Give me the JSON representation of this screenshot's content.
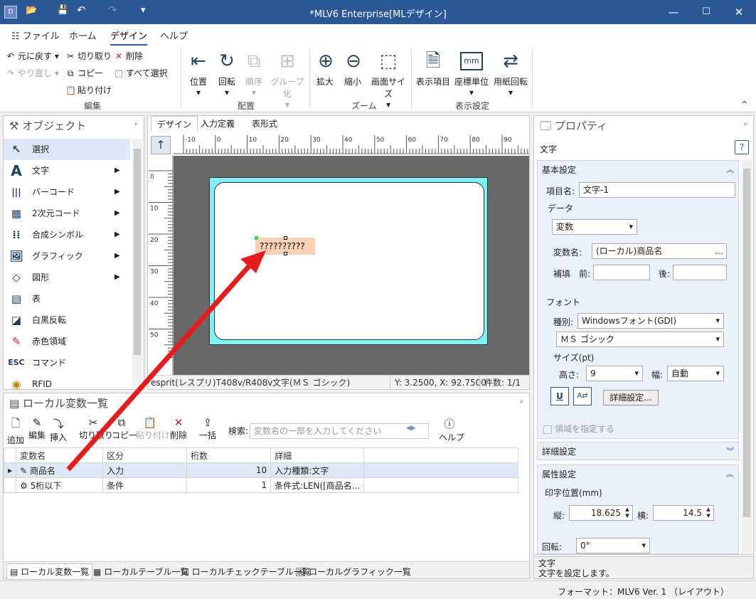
{
  "window": {
    "app_icon": "D",
    "title": "*MLV6 Enterprise[MLデザイン]",
    "min": "—",
    "max": "☐",
    "close": "✕"
  },
  "quick_access": {
    "open": "📂",
    "save": "💾",
    "undo": "↶",
    "redo": "↷",
    "customize": "▾"
  },
  "tabs": [
    {
      "label": "ファイル"
    },
    {
      "label": "ホーム"
    },
    {
      "label": "デザイン"
    },
    {
      "label": "ヘルプ"
    }
  ],
  "ribbon": {
    "edit": {
      "undo": "元に戻す",
      "redo": "やり直し",
      "cut": "切り取り",
      "copy": "コピー",
      "paste": "貼り付け",
      "delete": "削除",
      "select_all": "すべて選択",
      "group": "編集"
    },
    "arrange": {
      "position": "位置",
      "rotate": "回転",
      "order": "順序",
      "group_btn": "グループ化",
      "group": "配置"
    },
    "zoom": {
      "zoom_in": "拡大",
      "zoom_out": "縮小",
      "screen_size": "画面サイズ",
      "group": "ズーム"
    },
    "display": {
      "display_items": "表示項目",
      "unit": "座標単位",
      "unit_icon": "mm",
      "paper_rotate": "用紙回転",
      "group": "表示設定"
    },
    "collapse": "^"
  },
  "objects": {
    "title": "オブジェクト",
    "pin": "ᵖ",
    "items": [
      {
        "label": "選択",
        "icon": "↖"
      },
      {
        "label": "文字",
        "icon": "A"
      },
      {
        "label": "バーコード",
        "icon": "|||"
      },
      {
        "label": "2次元コード",
        "icon": "▦"
      },
      {
        "label": "合成シンボル",
        "icon": "⁞⁞"
      },
      {
        "label": "グラフィック",
        "icon": "🖼"
      },
      {
        "label": "図形",
        "icon": "◇"
      },
      {
        "label": "表",
        "icon": "▤"
      },
      {
        "label": "白黒反転",
        "icon": "◪"
      },
      {
        "label": "赤色領域",
        "icon": "✎"
      },
      {
        "label": "コマンド",
        "icon": "ESC"
      },
      {
        "label": "RFID",
        "icon": "◉"
      }
    ]
  },
  "designer": {
    "tabs": [
      "デザイン",
      "入力定義",
      "表形式"
    ],
    "ruler_x": [
      "-10",
      "0",
      "10",
      "20",
      "30",
      "40",
      "50",
      "60",
      "70",
      "80",
      "90"
    ],
    "ruler_y": [
      "0",
      "10",
      "20",
      "30",
      "40",
      "50"
    ],
    "sel_text": "??????????",
    "nav_btn": "↑",
    "status": {
      "printer": "esprit(レスプリ)T408v/R408v",
      "object": "文字(ＭＳ ゴシック)",
      "coords": "Y: 3.2500, X: 92.7500",
      "count": "件数: 1/1"
    }
  },
  "localvars": {
    "title": "ローカル変数一覧",
    "toolbar": {
      "add": "追加",
      "edit": "編集",
      "insert": "挿入",
      "cut": "切り取り",
      "copy": "コピー",
      "paste": "貼り付け",
      "delete": "削除",
      "batch": "一括",
      "search_label": "検索:",
      "search_placeholder": "変数名の一部を入力してください",
      "help": "ヘルプ"
    },
    "headers": [
      "変数名",
      "区分",
      "桁数",
      "詳細"
    ],
    "rows": [
      {
        "name": "商品名",
        "kind": "入力",
        "digits": "10",
        "detail": "入力種類:文字"
      },
      {
        "name": "5桁以下",
        "kind": "条件",
        "digits": "1",
        "detail": "条件式:LEN([商品名..."
      }
    ],
    "bottom_tabs": [
      "ローカル変数一覧",
      "ローカルテーブル一覧",
      "ローカルチェックテーブル一覧",
      "ローカルグラフィック一覧"
    ]
  },
  "props": {
    "title": "プロパティ",
    "object_type": "文字",
    "basic": {
      "header": "基本設定",
      "item_name_label": "項目名:",
      "item_name": "文字-1",
      "data_label": "データ",
      "data_type": "変数",
      "var_name_label": "変数名:",
      "var_name": "(ローカル)商品名",
      "complement_label": "補填",
      "before_label": "前:",
      "after_label": "後:",
      "font_label": "フォント",
      "kind_label": "種別:",
      "font_kind": "Windowsフォント(GDI)",
      "font_name": "ＭＳ ゴシック",
      "size_label": "サイズ(pt)",
      "height_label": "高さ:",
      "height": "9",
      "width_label": "幅:",
      "width": "自動",
      "detail_btn": "詳細設定...",
      "area_check": "領域を指定する"
    },
    "detail_header": "詳細設定",
    "attr": {
      "header": "属性設定",
      "print_pos": "印字位置(mm)",
      "v_label": "縦:",
      "v_value": "18.625",
      "h_label": "横:",
      "h_value": "14.5",
      "rotate_label": "回転:",
      "rotate_value": "0°"
    },
    "desc_title": "文字",
    "desc_text": "文字を設定します。"
  },
  "footer": "フォーマット：MLV6 Ver. 1 （レイアウト）"
}
